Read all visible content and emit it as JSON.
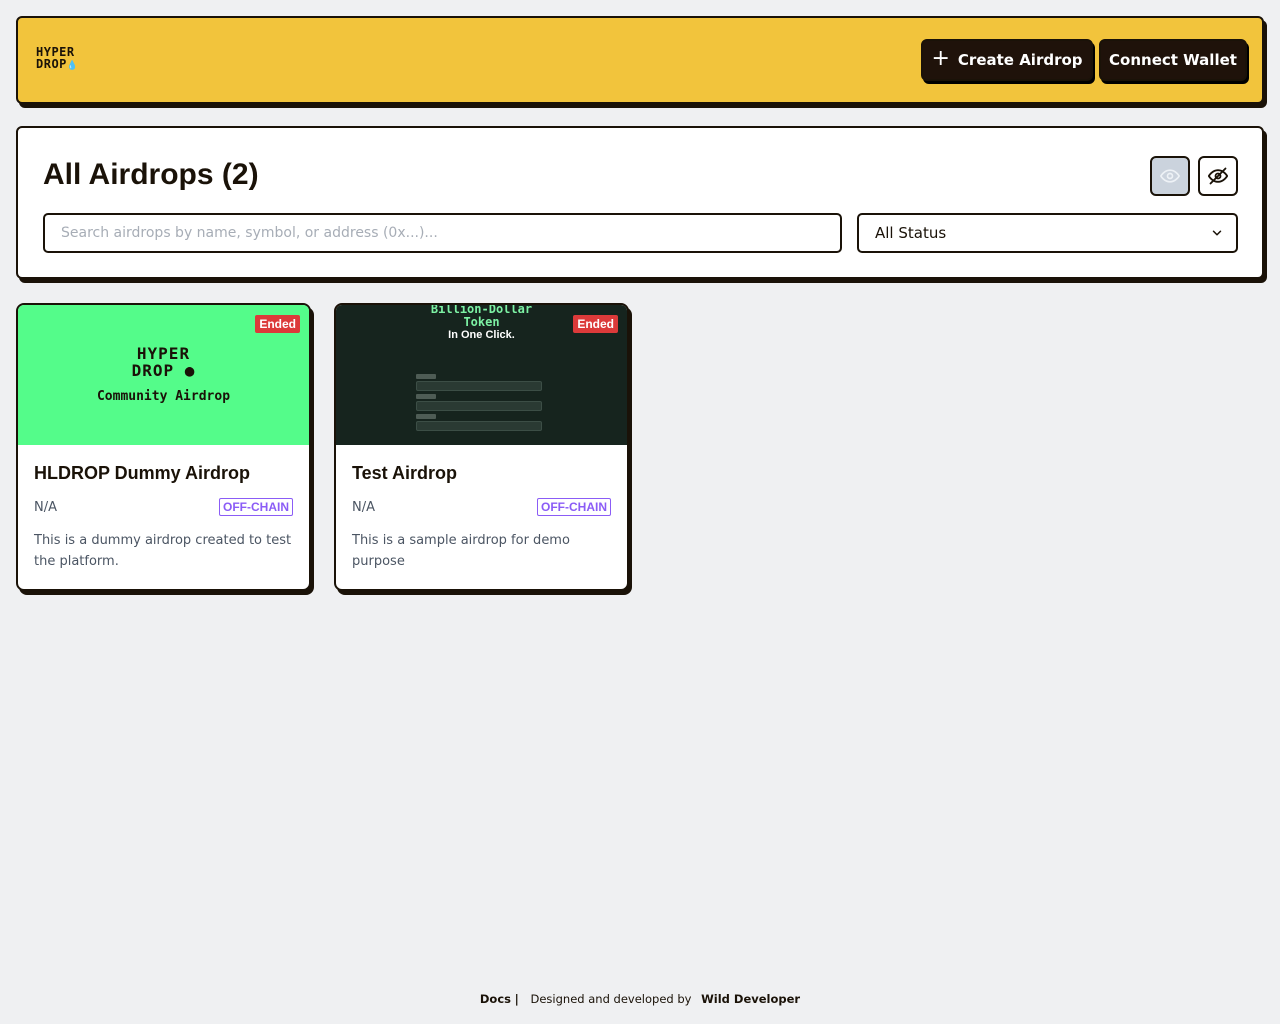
{
  "header": {
    "logo_line1": "HYPER",
    "logo_line2": "DROP",
    "create_label": "Create Airdrop",
    "wallet_label": "Connect Wallet"
  },
  "panel": {
    "title": "All Airdrops (2)",
    "search_placeholder": "Search airdrops by name, symbol, or address (0x...)...",
    "search_value": "",
    "status_selected": "All Status"
  },
  "cards": [
    {
      "image": {
        "line1": "HYPER",
        "line2": "DROP",
        "subtitle": "Community Airdrop",
        "bg": "#54fc8a"
      },
      "status": "Ended",
      "title": "HLDROP Dummy Airdrop",
      "amount": "N/A",
      "tag": "OFF-CHAIN",
      "description": "This is a dummy airdrop created to test the platform."
    },
    {
      "image": {
        "title_line1": "Billion-Dollar",
        "title_line2": "Token",
        "subtitle": "In One Click.",
        "bg": "#16241e"
      },
      "status": "Ended",
      "title": "Test Airdrop",
      "amount": "N/A",
      "tag": "OFF-CHAIN",
      "description": "This is a sample airdrop for demo purpose"
    }
  ],
  "footer": {
    "docs": "Docs",
    "separator": "|",
    "designed": "Designed and developed by",
    "developer": "Wild Developer"
  },
  "colors": {
    "accent": "#f2c43c",
    "dark": "#1f120a",
    "badge_red": "#dc3a3a",
    "tag_purple": "#8b5cf6",
    "background": "#eff0f2"
  },
  "icons": [
    "plus-icon",
    "droplet-icon",
    "eye-icon",
    "eye-off-icon",
    "chevron-down-icon"
  ]
}
